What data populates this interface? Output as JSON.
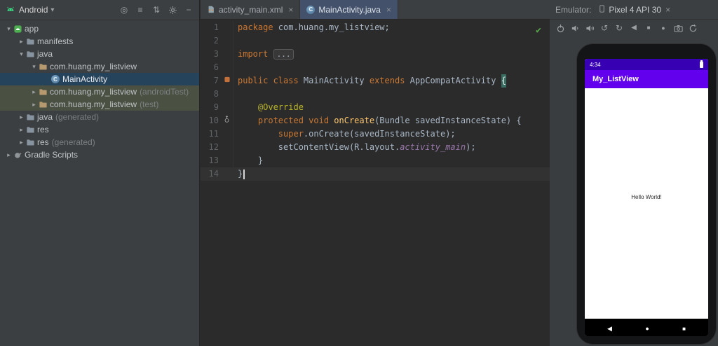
{
  "colors": {
    "panel_bg": "#3c3f41",
    "editor_bg": "#2b2b2b",
    "selection": "#26435c",
    "test_highlight": "#4b5142",
    "tab_active": "#44516b",
    "status_bar": "#3700b3",
    "app_bar": "#6200ee",
    "inspection_ok": "#57a64a"
  },
  "project": {
    "header": {
      "title": "Android",
      "icons": [
        "locate-icon",
        "collapse-all-icon",
        "sort-icon",
        "gear-icon",
        "hide-icon"
      ]
    },
    "items": [
      {
        "label": "app",
        "depth": 0,
        "chevron": "down",
        "icon": "android-app-icon"
      },
      {
        "label": "manifests",
        "depth": 1,
        "chevron": "right",
        "icon": "folder-icon"
      },
      {
        "label": "java",
        "depth": 1,
        "chevron": "down",
        "icon": "folder-icon"
      },
      {
        "label": "com.huang.my_listview",
        "depth": 2,
        "chevron": "down",
        "icon": "package-icon"
      },
      {
        "label": "MainActivity",
        "depth": 3,
        "chevron": "none",
        "icon": "class-icon",
        "state": "selected"
      },
      {
        "label": "com.huang.my_listview",
        "suffix": "(androidTest)",
        "depth": 2,
        "chevron": "right",
        "icon": "package-icon",
        "state": "test"
      },
      {
        "label": "com.huang.my_listview",
        "suffix": "(test)",
        "depth": 2,
        "chevron": "right",
        "icon": "package-icon",
        "state": "test"
      },
      {
        "label": "java",
        "suffix": "(generated)",
        "depth": 1,
        "chevron": "right",
        "icon": "folder-icon"
      },
      {
        "label": "res",
        "depth": 1,
        "chevron": "right",
        "icon": "res-folder-icon"
      },
      {
        "label": "res",
        "suffix": "(generated)",
        "depth": 1,
        "chevron": "right",
        "icon": "res-folder-icon"
      },
      {
        "label": "Gradle Scripts",
        "depth": 0,
        "chevron": "right",
        "icon": "gradle-icon"
      }
    ]
  },
  "tabs": [
    {
      "label": "activity_main.xml",
      "icon": "xml-file-icon",
      "active": false
    },
    {
      "label": "MainActivity.java",
      "icon": "class-icon",
      "active": true
    }
  ],
  "editor": {
    "status_icon": "check-icon",
    "lines": [
      {
        "num": "1",
        "segments": [
          {
            "t": "package ",
            "c": "kw"
          },
          {
            "t": "com.huang.my_listview;",
            "c": "pl"
          }
        ]
      },
      {
        "num": "2",
        "segments": []
      },
      {
        "num": "3",
        "segments": [
          {
            "t": "import ",
            "c": "kw"
          },
          {
            "t": "...",
            "c": "fold"
          }
        ]
      },
      {
        "num": "6",
        "segments": []
      },
      {
        "num": "7",
        "gutter": "class-marker-icon",
        "segments": [
          {
            "t": "public class ",
            "c": "kw"
          },
          {
            "t": "MainActivity ",
            "c": "pl"
          },
          {
            "t": "extends ",
            "c": "kw"
          },
          {
            "t": "AppCompatActivity ",
            "c": "pl"
          },
          {
            "t": "{",
            "c": "brace-hl"
          }
        ]
      },
      {
        "num": "8",
        "segments": []
      },
      {
        "num": "9",
        "segments": [
          {
            "t": "    ",
            "c": "pl"
          },
          {
            "t": "@Override",
            "c": "ann"
          }
        ]
      },
      {
        "num": "10",
        "gutter": "override-marker-icon",
        "segments": [
          {
            "t": "    ",
            "c": "pl"
          },
          {
            "t": "protected void ",
            "c": "kw"
          },
          {
            "t": "onCreate",
            "c": "method"
          },
          {
            "t": "(Bundle savedInstanceState) {",
            "c": "pl"
          }
        ]
      },
      {
        "num": "11",
        "segments": [
          {
            "t": "        ",
            "c": "pl"
          },
          {
            "t": "super",
            "c": "kw"
          },
          {
            "t": ".onCreate(savedInstanceState);",
            "c": "pl"
          }
        ]
      },
      {
        "num": "12",
        "segments": [
          {
            "t": "        setContentView(R.layout.",
            "c": "pl"
          },
          {
            "t": "activity_main",
            "c": "field"
          },
          {
            "t": ");",
            "c": "pl"
          }
        ]
      },
      {
        "num": "13",
        "segments": [
          {
            "t": "    }",
            "c": "pl"
          }
        ]
      },
      {
        "num": "14",
        "current": true,
        "segments": [
          {
            "t": "}",
            "c": "pl"
          }
        ]
      }
    ]
  },
  "emulator": {
    "label": "Emulator:",
    "tab": {
      "label": "Pixel 4 API 30",
      "icon": "phone-icon"
    },
    "toolbar": [
      "power-icon",
      "volume-down-icon",
      "volume-up-icon",
      "rotate-left-icon",
      "rotate-right-icon",
      "back-icon",
      "overview-icon",
      "home-icon",
      "camera-icon",
      "snapshot-icon"
    ],
    "phone": {
      "time": "4:34",
      "app_title": "My_ListView",
      "content_text": "Hello World!",
      "nav_icons": [
        "back-nav-icon",
        "home-nav-icon",
        "recents-nav-icon"
      ]
    }
  }
}
